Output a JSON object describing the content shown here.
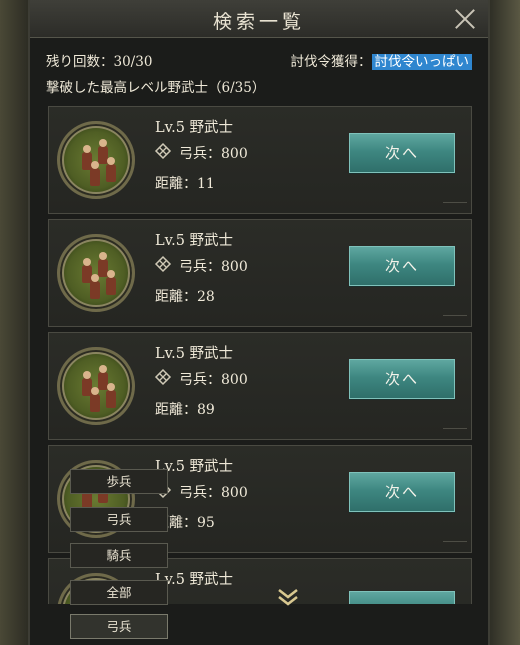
{
  "title": "検索一覧",
  "stats": {
    "remaining": "残り回数：30/30",
    "token_label": "討伐令獲得：",
    "token_value": "討伐令いっぱい",
    "best_defeated": "撃破した最高レベル野武士（6/35）"
  },
  "cards": [
    {
      "level": "Lv.5 野武士",
      "troop": "弓兵：800",
      "distance": "距離：11",
      "button": "次へ"
    },
    {
      "level": "Lv.5 野武士",
      "troop": "弓兵：800",
      "distance": "距離：28",
      "button": "次へ"
    },
    {
      "level": "Lv.5 野武士",
      "troop": "弓兵：800",
      "distance": "距離：89",
      "button": "次へ"
    },
    {
      "level": "Lv.5 野武士",
      "troop": "弓兵：800",
      "distance": "距離：95",
      "button": "次へ"
    },
    {
      "level": "Lv.5 野武士",
      "troop": "",
      "distance": "",
      "button": ""
    }
  ],
  "filter": {
    "options": [
      "歩兵",
      "弓兵",
      "騎兵",
      "全部"
    ],
    "selected": "弓兵"
  },
  "icons": {
    "close": "close-icon",
    "unit": "bow-unit-icon",
    "scroll": "double-chevron-down-icon"
  },
  "colors": {
    "button": "#3e8781",
    "highlight": "#2f86cf"
  }
}
